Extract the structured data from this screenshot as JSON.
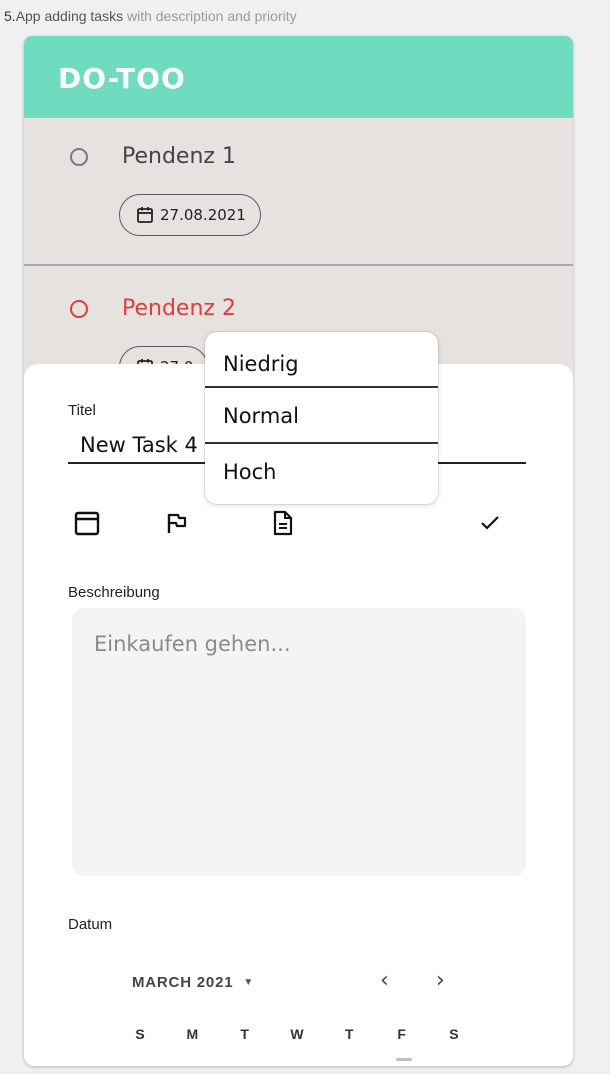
{
  "caption": {
    "number": "5.",
    "lead": "App adding tasks",
    "rest": " with description and priority"
  },
  "app": {
    "title": "DO-TOO",
    "accent": "#6fdcc0",
    "overdue_color": "#e53b3b"
  },
  "tasks": [
    {
      "name": "Pendenz 1",
      "date": "27.08.2021",
      "overdue": false
    },
    {
      "name": "Pendenz 2",
      "date": "27.0",
      "overdue": true
    }
  ],
  "form": {
    "title_label": "Titel",
    "title_value": "New Task 4",
    "icons": [
      "calendar-icon",
      "flag-icon",
      "document-icon",
      "check-icon"
    ],
    "description_label": "Beschreibung",
    "description_placeholder": "Einkaufen gehen...",
    "date_label": "Datum"
  },
  "calendar": {
    "month": "MARCH 2021",
    "prev": "‹",
    "next": "›",
    "weekdays": [
      "S",
      "M",
      "T",
      "W",
      "T",
      "F",
      "S"
    ]
  },
  "priority_menu": {
    "options": [
      "Niedrig",
      "Normal",
      "Hoch"
    ]
  }
}
